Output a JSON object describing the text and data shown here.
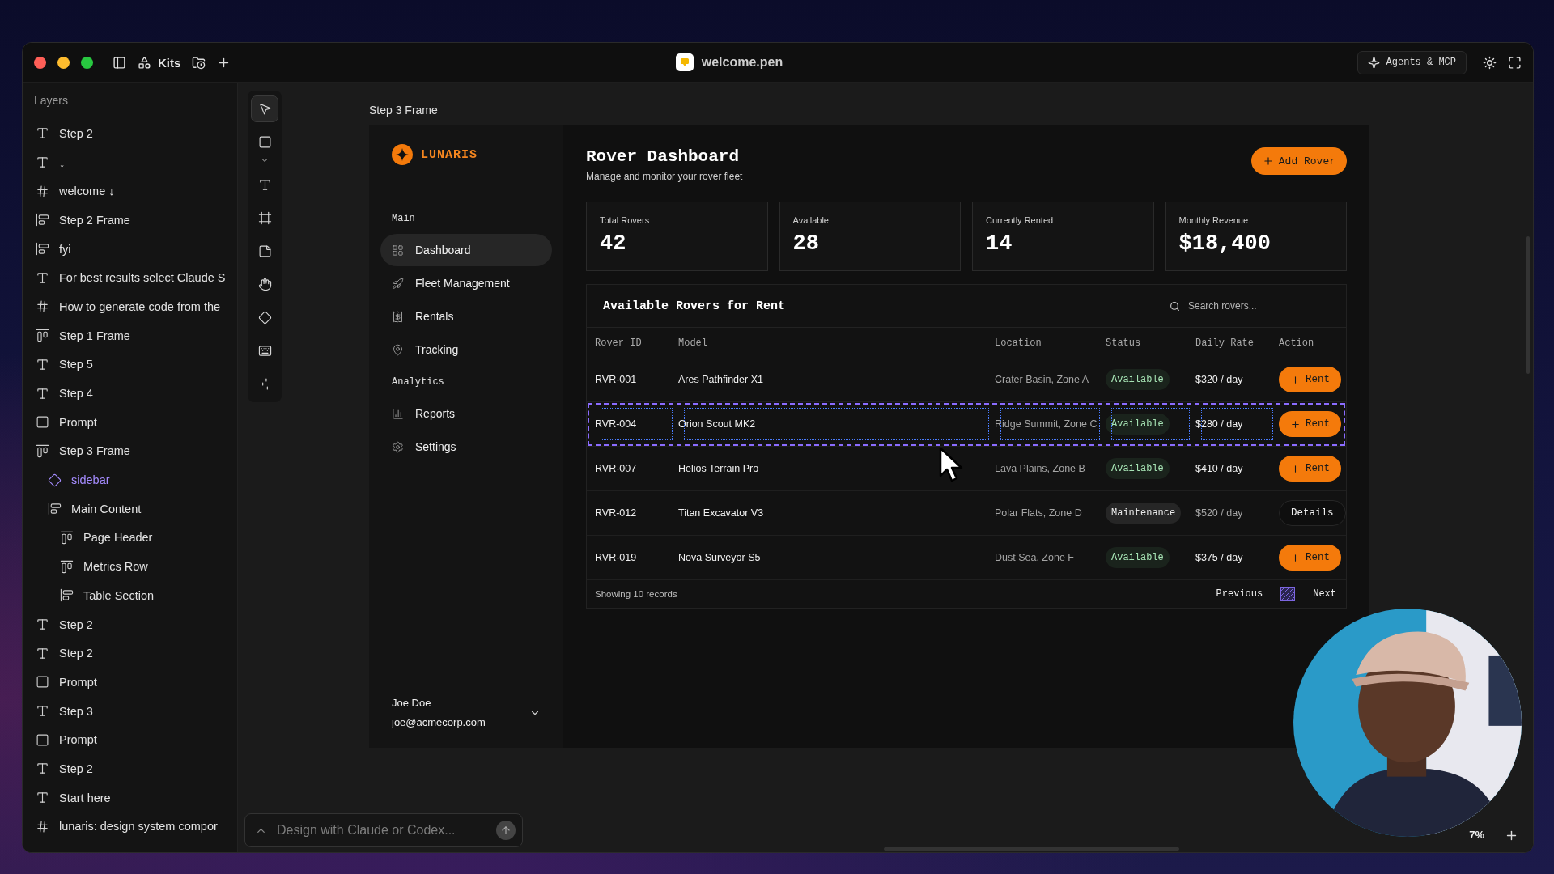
{
  "titlebar": {
    "kits_label": "Kits",
    "file_name": "welcome.pen",
    "agents_button": "Agents & MCP"
  },
  "layers": {
    "title": "Layers",
    "items": [
      {
        "kind": "text",
        "label": "Step 2",
        "selected": false
      },
      {
        "kind": "text",
        "label": "↓",
        "selected": false
      },
      {
        "kind": "frame",
        "label": "welcome ↓",
        "selected": false
      },
      {
        "kind": "hstack",
        "label": "Step 2 Frame",
        "selected": false
      },
      {
        "kind": "hstack",
        "label": "fyi",
        "selected": false
      },
      {
        "kind": "text",
        "label": "For best results select Claude S",
        "selected": false
      },
      {
        "kind": "frame",
        "label": "How to generate code from the",
        "selected": false
      },
      {
        "kind": "vstack",
        "label": "Step 1 Frame",
        "selected": false
      },
      {
        "kind": "text",
        "label": "Step 5",
        "selected": false
      },
      {
        "kind": "text",
        "label": "Step 4",
        "selected": false
      },
      {
        "kind": "rect",
        "label": "Prompt",
        "selected": false
      },
      {
        "kind": "vstack",
        "label": "Step 3 Frame",
        "selected": false,
        "children": [
          {
            "kind": "component",
            "label": "sidebar",
            "selected": true
          },
          {
            "kind": "hstack",
            "label": "Main Content",
            "selected": false,
            "children": [
              {
                "kind": "vstack",
                "label": "Page Header",
                "selected": false
              },
              {
                "kind": "vstack",
                "label": "Metrics Row",
                "selected": false
              },
              {
                "kind": "hstack",
                "label": "Table Section",
                "selected": false
              }
            ]
          }
        ]
      },
      {
        "kind": "text",
        "label": "Step 2",
        "selected": false
      },
      {
        "kind": "text",
        "label": "Step 2",
        "selected": false
      },
      {
        "kind": "rect",
        "label": "Prompt",
        "selected": false
      },
      {
        "kind": "text",
        "label": "Step 3",
        "selected": false
      },
      {
        "kind": "rect",
        "label": "Prompt",
        "selected": false
      },
      {
        "kind": "text",
        "label": "Step 2",
        "selected": false
      },
      {
        "kind": "text",
        "label": "Start here",
        "selected": false
      },
      {
        "kind": "frame",
        "label": "lunaris: design system compor",
        "selected": false
      }
    ]
  },
  "tools": [
    {
      "kind": "pointer",
      "selected": true
    },
    {
      "kind": "rect",
      "selected": false
    },
    {
      "kind": "text",
      "selected": false
    },
    {
      "kind": "frame",
      "selected": false
    },
    {
      "kind": "note",
      "selected": false
    },
    {
      "kind": "hand",
      "selected": false
    },
    {
      "kind": "component",
      "selected": false
    },
    {
      "kind": "keyboard",
      "selected": false
    },
    {
      "kind": "sliders",
      "selected": false
    }
  ],
  "canvas": {
    "frame_label": "Step 3 Frame",
    "prompt": {
      "placeholder": "Design with Claude or Codex..."
    },
    "zoom": "7%"
  },
  "app": {
    "logo": "LUNARIS",
    "sections": [
      {
        "title": "Main",
        "items": [
          {
            "kind": "grid",
            "label": "Dashboard",
            "selected": true
          },
          {
            "kind": "rocket",
            "label": "Fleet Management",
            "selected": false
          },
          {
            "kind": "receipt",
            "label": "Rentals",
            "selected": false
          },
          {
            "kind": "pin",
            "label": "Tracking",
            "selected": false
          }
        ]
      },
      {
        "title": "Analytics",
        "items": [
          {
            "kind": "chart",
            "label": "Reports",
            "selected": false
          },
          {
            "kind": "gear",
            "label": "Settings",
            "selected": false
          }
        ]
      }
    ],
    "user": {
      "name": "Joe Doe",
      "email": "joe@acmecorp.com"
    }
  },
  "dashboard": {
    "title": "Rover Dashboard",
    "subtitle": "Manage and monitor your rover fleet",
    "add_button": "Add Rover",
    "metrics": [
      {
        "label": "Total Rovers",
        "value": "42"
      },
      {
        "label": "Available",
        "value": "28"
      },
      {
        "label": "Currently Rented",
        "value": "14"
      },
      {
        "label": "Monthly Revenue",
        "value": "$18,400"
      }
    ],
    "table": {
      "title": "Available Rovers for Rent",
      "search": {
        "placeholder": "Search rovers..."
      },
      "columns": [
        "Rover ID",
        "Model",
        "Location",
        "Status",
        "Daily Rate",
        "Action"
      ],
      "rows": [
        {
          "id": "RVR-001",
          "model": "Ares Pathfinder X1",
          "location": "Crater Basin, Zone A",
          "status": {
            "kind": "available",
            "label": "Available"
          },
          "rate": "$320 / day",
          "action": {
            "kind": "rent",
            "label": "Rent"
          },
          "selected": false
        },
        {
          "id": "RVR-004",
          "model": "Orion Scout MK2",
          "location": "Ridge Summit, Zone C",
          "status": {
            "kind": "available",
            "label": "Available"
          },
          "rate": "$280 / day",
          "action": {
            "kind": "rent",
            "label": "Rent"
          },
          "selected": true
        },
        {
          "id": "RVR-007",
          "model": "Helios Terrain Pro",
          "location": "Lava Plains, Zone B",
          "status": {
            "kind": "available",
            "label": "Available"
          },
          "rate": "$410 / day",
          "action": {
            "kind": "rent",
            "label": "Rent"
          },
          "selected": false
        },
        {
          "id": "RVR-012",
          "model": "Titan Excavator V3",
          "location": "Polar Flats, Zone D",
          "status": {
            "kind": "maintenance",
            "label": "Maintenance"
          },
          "rate": "$520 / day",
          "action": {
            "kind": "details",
            "label": "Details"
          },
          "selected": false
        },
        {
          "id": "RVR-019",
          "model": "Nova Surveyor S5",
          "location": "Dust Sea, Zone F",
          "status": {
            "kind": "available",
            "label": "Available"
          },
          "rate": "$375 / day",
          "action": {
            "kind": "rent",
            "label": "Rent"
          },
          "selected": false
        }
      ],
      "footer": "Showing 10 records",
      "pagination": {
        "previous": "Previous",
        "next": "Next"
      }
    }
  }
}
